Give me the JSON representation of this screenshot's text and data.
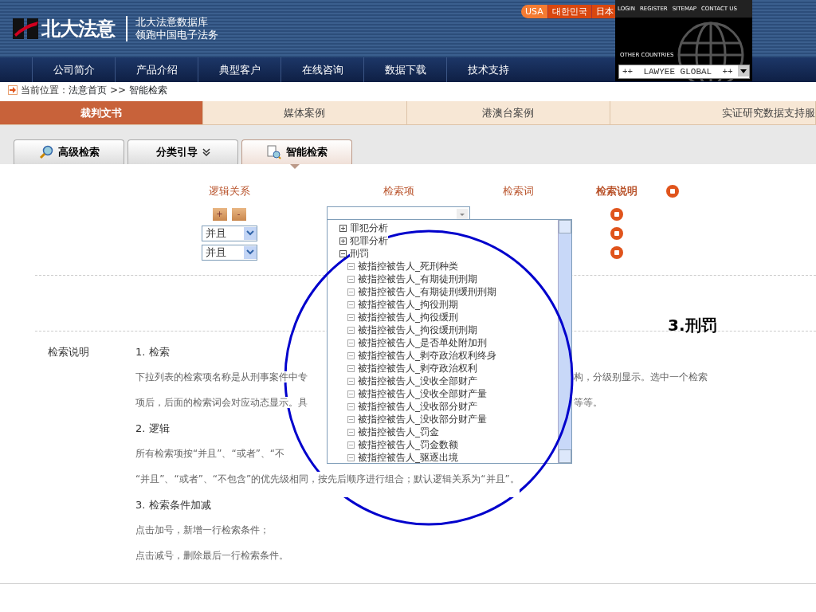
{
  "header": {
    "logo_text": "北大法意",
    "tagline_lines": [
      "北大法意数据库",
      "领跑中国电子法务"
    ],
    "country_buttons": [
      {
        "label": "USA",
        "selected": true
      },
      {
        "label": "대한민국",
        "selected": false
      },
      {
        "label": "日本",
        "selected": false
      }
    ],
    "top_links": [
      "LOGIN",
      "REGISTER",
      "SITEMAP",
      "CONTACT US"
    ],
    "other_countries_label": "OTHER COUNTRIES",
    "global_select": {
      "value": "++  LAWYEE GLOBAL  ++"
    }
  },
  "nav_menu": [
    "公司简介",
    "产品介绍",
    "典型客户",
    "在线咨询",
    "数据下载",
    "技术支持"
  ],
  "breadcrumb": {
    "label": "当前位置：",
    "links": [
      "法意首页",
      "智能检索"
    ],
    "separator": ">>"
  },
  "category_tabs": [
    {
      "label": "裁判文书",
      "selected": true
    },
    {
      "label": "媒体案例",
      "selected": false
    },
    {
      "label": "港澳台案例",
      "selected": false
    },
    {
      "label": "实证研究数据支持服",
      "selected": false
    }
  ],
  "search_mode_tabs": [
    {
      "label": "高级检索",
      "kind": "magnifier",
      "selected": false
    },
    {
      "label": "分类引导",
      "kind": "chevron",
      "selected": false
    },
    {
      "label": "智能检索",
      "kind": "document",
      "selected": true
    }
  ],
  "form": {
    "columns": [
      "逻辑关系",
      "检索项",
      "检索词",
      "检索说明"
    ],
    "add_button": "+",
    "remove_button": "-",
    "logic_selects": [
      "并且",
      "并且"
    ],
    "search_item_tree": [
      {
        "label": "罪犯分析",
        "expanded": false
      },
      {
        "label": "犯罪分析",
        "expanded": false
      },
      {
        "label": "刑罚",
        "expanded": true,
        "children": [
          {
            "label": "被指控被告人_死刑种类"
          },
          {
            "label": "被指控被告人_有期徒刑刑期"
          },
          {
            "label": "被指控被告人_有期徒刑缓刑刑期"
          },
          {
            "label": "被指控被告人_拘役刑期"
          },
          {
            "label": "被指控被告人_拘役缓刑"
          },
          {
            "label": "被指控被告人_拘役缓刑刑期"
          },
          {
            "label": "被指控被告人_是否单处附加刑"
          },
          {
            "label": "被指控被告人_剥夺政治权利终身"
          },
          {
            "label": "被指控被告人_剥夺政治权利"
          },
          {
            "label": "被指控被告人_没收全部财产"
          },
          {
            "label": "被指控被告人_没收全部财产量"
          },
          {
            "label": "被指控被告人_没收部分财产"
          },
          {
            "label": "被指控被告人_没收部分财产量"
          },
          {
            "label": "被指控被告人_罚金"
          },
          {
            "label": "被指控被告人_罚金数额"
          },
          {
            "label": "被指控被告人_驱逐出境"
          }
        ]
      }
    ]
  },
  "annotation": {
    "label": "3.刑罚"
  },
  "explanation": {
    "title": "检索说明",
    "sections": [
      {
        "heading": "1. 检索",
        "lines": [
          [
            "下拉列表的检索项名称是从刑事案件中专",
            "构，分级别显示。选中一个检索"
          ],
          [
            "项后，后面的检索词会对应动态显示。具",
            "等等。"
          ]
        ]
      },
      {
        "heading": "2. 逻辑",
        "lines": [
          [
            "所有检索项按“并且”、“或者”、“不"
          ],
          [
            "“并且”、“或者”、“不包含”的优先级相同，按先后顺序进行组合；默认逻辑关系为“并且”。"
          ]
        ]
      },
      {
        "heading": "3. 检索条件加减",
        "lines": [
          [
            "点击加号，新增一行检索条件；"
          ],
          [
            "点击减号，删除最后一行检索条件。"
          ]
        ]
      }
    ]
  }
}
